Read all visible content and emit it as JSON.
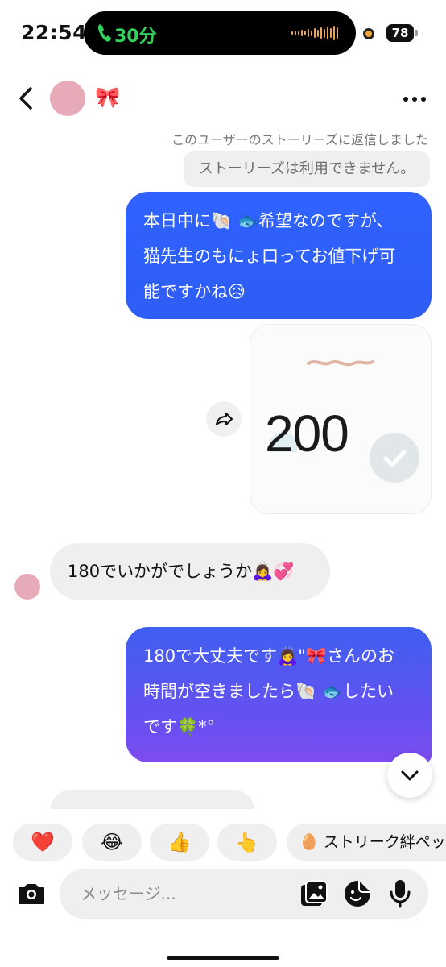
{
  "status_bar": {
    "time": "22:54",
    "call_duration": "30分",
    "battery": "78"
  },
  "header": {
    "contact_name": "🎀"
  },
  "story_reply": {
    "note": "このユーザーのストーリーズに返信しました",
    "unavailable": "ストーリーズは利用できません。"
  },
  "messages": [
    {
      "from": "me",
      "lines": [
        "本日中に🐚 🐟希望なのですが、",
        "猫先生のもにょ口ってお値下げ可",
        "能ですかね😥"
      ]
    },
    {
      "from": "me",
      "type": "image",
      "image_text": "200"
    },
    {
      "from": "them",
      "text": "180でいかがでしょうか🙇‍♀️💞"
    },
    {
      "from": "me",
      "lines": [
        "180で大丈夫です🙇‍♀️\"🎀さんのお",
        "時間が空きましたら🐚 🐟したい",
        "です🍀*°"
      ]
    }
  ],
  "quick_reactions": [
    "❤️",
    "😂",
    "👍",
    "👆"
  ],
  "streak_chip": {
    "icon": "🥚",
    "label": "ストリーク絆ペッ"
  },
  "composer": {
    "placeholder": "メッセージ..."
  },
  "colors": {
    "outgoing_bubble": "#2f62ff",
    "outgoing_bubble_gradient_end": "#7f4cf0",
    "incoming_bubble": "#efefef",
    "avatar": "#e7aab8",
    "call_green": "#33d15c"
  }
}
